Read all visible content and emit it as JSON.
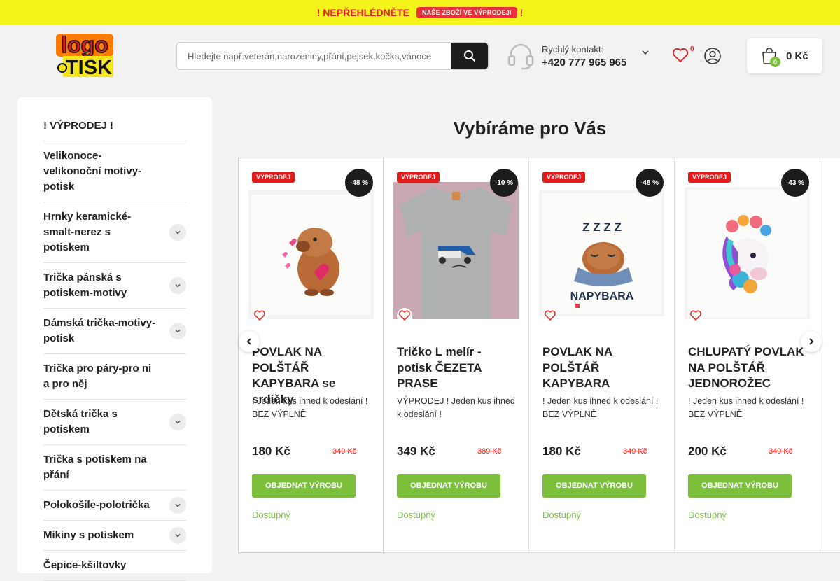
{
  "banner": {
    "announce": "! NEPŘEHLÉDNĚTE",
    "pill": "NAŠE ZBOŽÍ VE VÝPRODEJI",
    "bang": "!"
  },
  "header": {
    "logo": {
      "word1": "logo",
      "word2": "TISK"
    },
    "search_placeholder": "Hledejte např:veterán,narozeniny,přání,pejsek,kočka,vánoce",
    "contact_label": "Rychlý kontakt:",
    "contact_phone": "+420 777 965 965",
    "wishlist_count": "0",
    "cart_count": "0",
    "cart_total": "0 Kč"
  },
  "sidebar": {
    "categories": [
      {
        "label": "! VÝPRODEJ !",
        "expandable": false
      },
      {
        "label": "Velikonoce-velikonoční motivy-potisk",
        "expandable": false
      },
      {
        "label": "Hrnky keramické-smalt-nerez s potiskem",
        "expandable": true
      },
      {
        "label": "Trička pánská s potiskem-motivy",
        "expandable": true
      },
      {
        "label": "Dámská trička-motivy-potisk",
        "expandable": true
      },
      {
        "label": "Trička pro páry-pro ni a pro něj",
        "expandable": false
      },
      {
        "label": "Dětská trička s potiskem",
        "expandable": true
      },
      {
        "label": "Trička s potiskem na přání",
        "expandable": false
      },
      {
        "label": "Polokošile-polotrička",
        "expandable": true
      },
      {
        "label": "Mikiny s potiskem",
        "expandable": true
      },
      {
        "label": "Čepice-kšiltovky",
        "expandable": false
      }
    ]
  },
  "main": {
    "title": "Vybíráme pro Vás",
    "products": [
      {
        "badge": "VÝPRODEJ",
        "discount": "-48 %",
        "name": "POVLAK NA POLŠTÁŘ KAPYBARA se srdíčky",
        "desc": "! Jeden kus ihned k odeslání ! BEZ VÝPLNĚ",
        "price": "180 Kč",
        "old_price": "349 Kč",
        "button": "OBJEDNAT VÝROBU",
        "availability": "Dostupný",
        "image": "capybara-hearts"
      },
      {
        "badge": "VÝPRODEJ",
        "discount": "-10 %",
        "name": "Tričko L melír - potisk ČEZETA PRASE",
        "desc": "VÝPRODEJ ! Jeden kus ihned k odeslání !",
        "price": "349 Kč",
        "old_price": "389 Kč",
        "button": "OBJEDNAT VÝROBU",
        "availability": "Dostupný",
        "image": "tshirt-cezeta"
      },
      {
        "badge": "VÝPRODEJ",
        "discount": "-48 %",
        "name": "POVLAK NA POLŠTÁŘ KAPYBARA",
        "desc": "! Jeden kus ihned k odeslání ! BEZ VÝPLNĚ",
        "price": "180 Kč",
        "old_price": "349 Kč",
        "button": "OBJEDNAT VÝROBU",
        "availability": "Dostupný",
        "image": "napybara"
      },
      {
        "badge": "VÝPRODEJ",
        "discount": "-43 %",
        "name": "CHLUPATÝ POVLAK NA POLŠTÁŘ JEDNOROŽEC",
        "desc": "! Jeden kus ihned k odeslání ! BEZ VÝPLNĚ",
        "price": "200 Kč",
        "old_price": "349 Kč",
        "button": "OBJEDNAT VÝROBU",
        "availability": "Dostupný",
        "image": "unicorn"
      }
    ],
    "napybara_text": "NAPYBARA",
    "zzz_text": "Z Z Z Z"
  }
}
